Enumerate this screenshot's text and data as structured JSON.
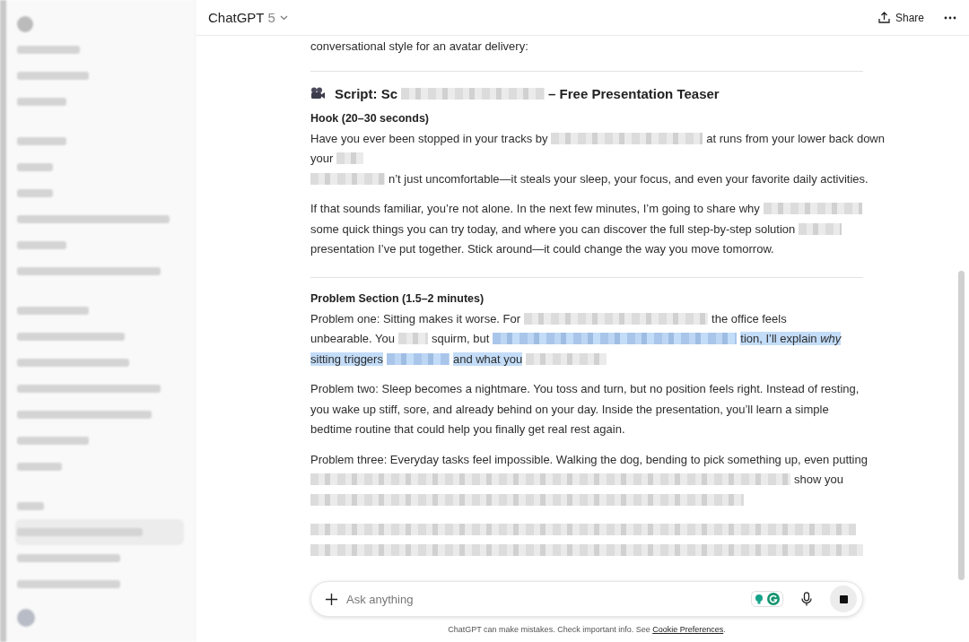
{
  "header": {
    "title": "ChatGPT",
    "model": "5",
    "share": "Share"
  },
  "blocks": [
    {
      "kind": "text",
      "lines": [
        [
          {
            "kind": "text",
            "text": "conversational style for an avatar delivery:",
            "selected": false
          }
        ]
      ]
    },
    {
      "kind": "rule"
    },
    {
      "kind": "heading",
      "lines": [
        [
          {
            "kind": "text",
            "text": "Script: Sc",
            "selected": false
          },
          {
            "kind": "redacted",
            "selected": false
          },
          {
            "kind": "text",
            "text": "– Free Presentation Teaser",
            "selected": false
          }
        ]
      ]
    },
    {
      "kind": "label",
      "lines": [
        [
          {
            "kind": "text",
            "text": "Hook (20–30 seconds)",
            "selected": false
          }
        ]
      ]
    },
    {
      "kind": "text",
      "lines": [
        [
          {
            "kind": "text",
            "text": "Have you ever been stopped in your tracks by",
            "selected": false
          },
          {
            "kind": "redacted",
            "selected": false
          },
          {
            "kind": "text",
            "text": "at runs from your lower back down",
            "selected": false
          }
        ],
        [
          {
            "kind": "text",
            "text": "your",
            "selected": false
          },
          {
            "kind": "redacted",
            "selected": false
          }
        ],
        [
          {
            "kind": "redacted",
            "selected": false
          },
          {
            "kind": "text",
            "text": "n’t just uncomfortable—it steals your sleep, your focus, and even your favorite daily activities.",
            "selected": false
          }
        ]
      ]
    },
    {
      "kind": "text",
      "lines": [
        [
          {
            "kind": "text",
            "text": "If that sounds familiar, you’re not alone. In the next few minutes, I’m going to share why",
            "selected": false
          },
          {
            "kind": "redacted",
            "selected": false
          }
        ],
        [
          {
            "kind": "text",
            "text": "some quick things you can try today, and where you can discover the full step-by-step solution",
            "selected": false
          },
          {
            "kind": "redacted",
            "selected": false
          }
        ],
        [
          {
            "kind": "text",
            "text": "presentation I’ve put together. Stick around—it could change the way you move tomorrow.",
            "selected": false
          }
        ]
      ]
    },
    {
      "kind": "rule"
    },
    {
      "kind": "label",
      "lines": [
        [
          {
            "kind": "text",
            "text": "Problem Section (1.5–2 minutes)",
            "selected": false
          }
        ]
      ]
    },
    {
      "kind": "text",
      "lines": [
        [
          {
            "kind": "text",
            "text": "Problem one: Sitting makes it worse. For",
            "selected": false
          },
          {
            "kind": "redacted",
            "selected": false
          },
          {
            "kind": "text",
            "text": "the office feels",
            "selected": false
          }
        ],
        [
          {
            "kind": "text",
            "text": "unbearable. You",
            "selected": false
          },
          {
            "kind": "redacted",
            "selected": false
          },
          {
            "kind": "text",
            "text": "squirm, but",
            "selected": false
          },
          {
            "kind": "redacted",
            "selected": true
          },
          {
            "kind": "text",
            "text": "tion, I’ll explain *why*",
            "selected": true
          }
        ],
        [
          {
            "kind": "text",
            "text": "sitting triggers",
            "selected": true
          },
          {
            "kind": "redacted",
            "selected": true
          },
          {
            "kind": "text",
            "text": "and what you",
            "selected": true
          },
          {
            "kind": "redacted",
            "selected": false
          }
        ]
      ]
    },
    {
      "kind": "text",
      "lines": [
        [
          {
            "kind": "text",
            "text": "Problem two: Sleep becomes a nightmare. You toss and turn, but no position feels right. Instead of resting,",
            "selected": false
          }
        ],
        [
          {
            "kind": "text",
            "text": "you wake up stiff, sore, and already behind on your day. Inside the presentation, you’ll learn a simple",
            "selected": false
          }
        ],
        [
          {
            "kind": "text",
            "text": "bedtime routine that could help you finally get real rest again.",
            "selected": false
          }
        ]
      ]
    },
    {
      "kind": "text",
      "lines": [
        [
          {
            "kind": "text",
            "text": "Problem three: Everyday tasks feel impossible. Walking the dog, bending to pick something up, even putting",
            "selected": false
          }
        ],
        [
          {
            "kind": "redacted",
            "selected": false
          },
          {
            "kind": "text",
            "text": "show you",
            "selected": false
          }
        ],
        [
          {
            "kind": "redacted",
            "selected": false
          }
        ]
      ]
    },
    {
      "kind": "text",
      "lines": [
        [
          {
            "kind": "redacted",
            "selected": false
          }
        ],
        [
          {
            "kind": "redacted",
            "selected": false
          }
        ]
      ]
    }
  ],
  "composer": {
    "placeholder": "Ask anything"
  },
  "footer": {
    "text": "ChatGPT can make mistakes. Check important info. See ",
    "link": "Cookie Preferences",
    "end": "."
  }
}
